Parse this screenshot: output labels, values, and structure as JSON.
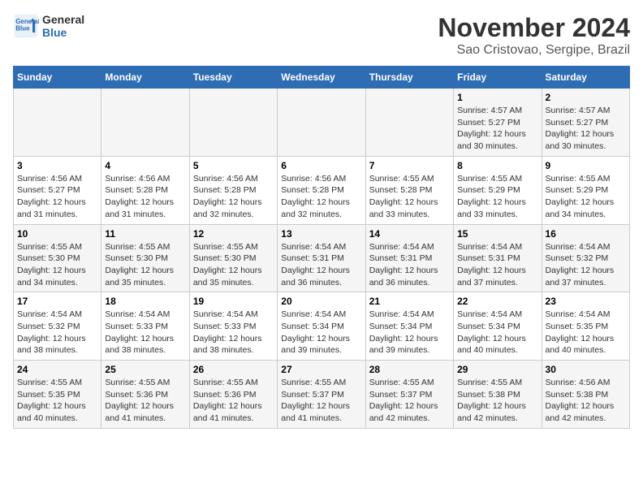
{
  "header": {
    "logo_line1": "General",
    "logo_line2": "Blue",
    "month": "November 2024",
    "location": "Sao Cristovao, Sergipe, Brazil"
  },
  "weekdays": [
    "Sunday",
    "Monday",
    "Tuesday",
    "Wednesday",
    "Thursday",
    "Friday",
    "Saturday"
  ],
  "weeks": [
    [
      {
        "day": "",
        "info": ""
      },
      {
        "day": "",
        "info": ""
      },
      {
        "day": "",
        "info": ""
      },
      {
        "day": "",
        "info": ""
      },
      {
        "day": "",
        "info": ""
      },
      {
        "day": "1",
        "info": "Sunrise: 4:57 AM\nSunset: 5:27 PM\nDaylight: 12 hours and 30 minutes."
      },
      {
        "day": "2",
        "info": "Sunrise: 4:57 AM\nSunset: 5:27 PM\nDaylight: 12 hours and 30 minutes."
      }
    ],
    [
      {
        "day": "3",
        "info": "Sunrise: 4:56 AM\nSunset: 5:27 PM\nDaylight: 12 hours and 31 minutes."
      },
      {
        "day": "4",
        "info": "Sunrise: 4:56 AM\nSunset: 5:28 PM\nDaylight: 12 hours and 31 minutes."
      },
      {
        "day": "5",
        "info": "Sunrise: 4:56 AM\nSunset: 5:28 PM\nDaylight: 12 hours and 32 minutes."
      },
      {
        "day": "6",
        "info": "Sunrise: 4:56 AM\nSunset: 5:28 PM\nDaylight: 12 hours and 32 minutes."
      },
      {
        "day": "7",
        "info": "Sunrise: 4:55 AM\nSunset: 5:28 PM\nDaylight: 12 hours and 33 minutes."
      },
      {
        "day": "8",
        "info": "Sunrise: 4:55 AM\nSunset: 5:29 PM\nDaylight: 12 hours and 33 minutes."
      },
      {
        "day": "9",
        "info": "Sunrise: 4:55 AM\nSunset: 5:29 PM\nDaylight: 12 hours and 34 minutes."
      }
    ],
    [
      {
        "day": "10",
        "info": "Sunrise: 4:55 AM\nSunset: 5:30 PM\nDaylight: 12 hours and 34 minutes."
      },
      {
        "day": "11",
        "info": "Sunrise: 4:55 AM\nSunset: 5:30 PM\nDaylight: 12 hours and 35 minutes."
      },
      {
        "day": "12",
        "info": "Sunrise: 4:55 AM\nSunset: 5:30 PM\nDaylight: 12 hours and 35 minutes."
      },
      {
        "day": "13",
        "info": "Sunrise: 4:54 AM\nSunset: 5:31 PM\nDaylight: 12 hours and 36 minutes."
      },
      {
        "day": "14",
        "info": "Sunrise: 4:54 AM\nSunset: 5:31 PM\nDaylight: 12 hours and 36 minutes."
      },
      {
        "day": "15",
        "info": "Sunrise: 4:54 AM\nSunset: 5:31 PM\nDaylight: 12 hours and 37 minutes."
      },
      {
        "day": "16",
        "info": "Sunrise: 4:54 AM\nSunset: 5:32 PM\nDaylight: 12 hours and 37 minutes."
      }
    ],
    [
      {
        "day": "17",
        "info": "Sunrise: 4:54 AM\nSunset: 5:32 PM\nDaylight: 12 hours and 38 minutes."
      },
      {
        "day": "18",
        "info": "Sunrise: 4:54 AM\nSunset: 5:33 PM\nDaylight: 12 hours and 38 minutes."
      },
      {
        "day": "19",
        "info": "Sunrise: 4:54 AM\nSunset: 5:33 PM\nDaylight: 12 hours and 38 minutes."
      },
      {
        "day": "20",
        "info": "Sunrise: 4:54 AM\nSunset: 5:34 PM\nDaylight: 12 hours and 39 minutes."
      },
      {
        "day": "21",
        "info": "Sunrise: 4:54 AM\nSunset: 5:34 PM\nDaylight: 12 hours and 39 minutes."
      },
      {
        "day": "22",
        "info": "Sunrise: 4:54 AM\nSunset: 5:34 PM\nDaylight: 12 hours and 40 minutes."
      },
      {
        "day": "23",
        "info": "Sunrise: 4:54 AM\nSunset: 5:35 PM\nDaylight: 12 hours and 40 minutes."
      }
    ],
    [
      {
        "day": "24",
        "info": "Sunrise: 4:55 AM\nSunset: 5:35 PM\nDaylight: 12 hours and 40 minutes."
      },
      {
        "day": "25",
        "info": "Sunrise: 4:55 AM\nSunset: 5:36 PM\nDaylight: 12 hours and 41 minutes."
      },
      {
        "day": "26",
        "info": "Sunrise: 4:55 AM\nSunset: 5:36 PM\nDaylight: 12 hours and 41 minutes."
      },
      {
        "day": "27",
        "info": "Sunrise: 4:55 AM\nSunset: 5:37 PM\nDaylight: 12 hours and 41 minutes."
      },
      {
        "day": "28",
        "info": "Sunrise: 4:55 AM\nSunset: 5:37 PM\nDaylight: 12 hours and 42 minutes."
      },
      {
        "day": "29",
        "info": "Sunrise: 4:55 AM\nSunset: 5:38 PM\nDaylight: 12 hours and 42 minutes."
      },
      {
        "day": "30",
        "info": "Sunrise: 4:56 AM\nSunset: 5:38 PM\nDaylight: 12 hours and 42 minutes."
      }
    ]
  ]
}
